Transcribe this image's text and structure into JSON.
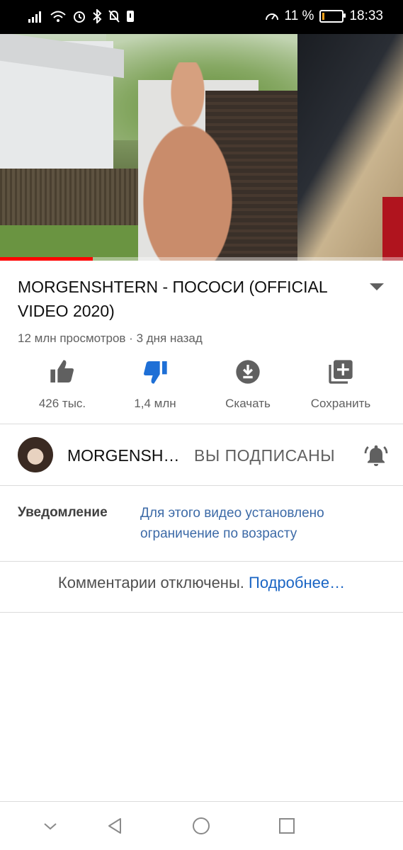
{
  "status_bar": {
    "battery_percent": "11 %",
    "time": "18:33",
    "battery_level": 0.11
  },
  "video": {
    "progress": 0.23
  },
  "title": "MORGENSHTERN - ПОСОСИ (OFFICIAL VIDEO 2020)",
  "meta": "12 млн просмотров · 3 дня назад",
  "actions": {
    "like_label": "426 тыс.",
    "dislike_label": "1,4 млн",
    "download_label": "Скачать",
    "save_label": "Сохранить"
  },
  "channel": {
    "name": "MORGENSH…",
    "subscribe_state": "ВЫ ПОДПИСАНЫ"
  },
  "notice": {
    "label": "Уведомление",
    "text": "Для этого видео установлено ограничение по возрасту"
  },
  "comments": {
    "disabled_text": "Комментарии отключены.",
    "more_link": "Подробнее…"
  },
  "colors": {
    "accent_blue": "#1a65c4",
    "dislike_blue": "#1e6fd6",
    "progress_red": "#ff0000"
  }
}
